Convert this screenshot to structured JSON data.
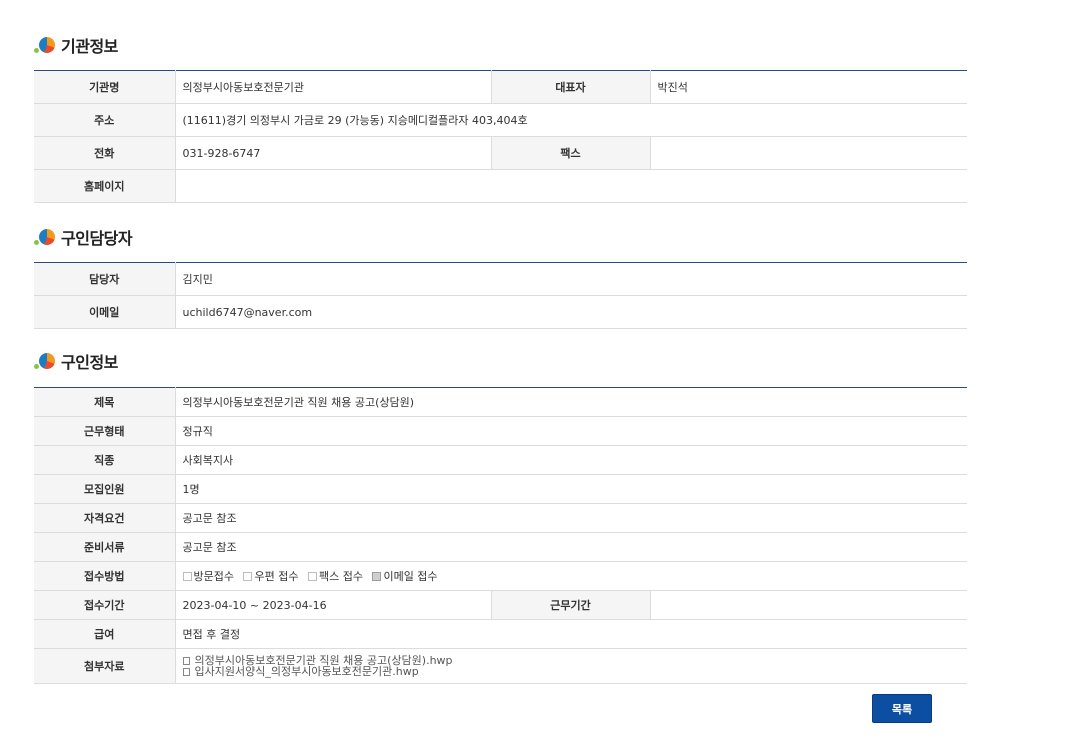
{
  "org_section": {
    "title": "기관정보",
    "name_label": "기관명",
    "name_value": "의정부시아동보호전문기관",
    "rep_label": "대표자",
    "rep_value": "박진석",
    "address_label": "주소",
    "address_value": "(11611)경기 의정부시 가금로 29 (가능동) 지승메디컬플라자 403,404호",
    "phone_label": "전화",
    "phone_value": "031-928-6747",
    "fax_label": "팩스",
    "fax_value": "",
    "homepage_label": "홈페이지",
    "homepage_value": ""
  },
  "contact_section": {
    "title": "구인담당자",
    "manager_label": "담당자",
    "manager_value": "김지민",
    "email_label": "이메일",
    "email_value": "uchild6747@naver.com"
  },
  "job_section": {
    "title": "구인정보",
    "subject_label": "제목",
    "subject_value": "의정부시아동보호전문기관 직원 채용 공고(상담원)",
    "work_type_label": "근무형태",
    "work_type_value": "정규직",
    "job_kind_label": "직종",
    "job_kind_value": "사회복지사",
    "headcount_label": "모집인원",
    "headcount_value": "1명",
    "qualification_label": "자격요건",
    "qualification_value": "공고문 참조",
    "documents_label": "준비서류",
    "documents_value": "공고문 참조",
    "method_label": "접수방법",
    "methods": [
      {
        "label": "방문접수",
        "checked": false
      },
      {
        "label": "우편 접수",
        "checked": false
      },
      {
        "label": "팩스 접수",
        "checked": false
      },
      {
        "label": "이메일 접수",
        "checked": true
      }
    ],
    "period_label": "접수기간",
    "period_value": "2023-04-10 ~ 2023-04-16",
    "work_period_label": "근무기간",
    "work_period_value": "",
    "salary_label": "급여",
    "salary_value": "면접 후 결정",
    "attachments_label": "첨부자료",
    "attachments": [
      "의정부시아동보호전문기관 직원 채용 공고(상담원).hwp",
      "입사지원서양식_의정부시아동보호전문기관.hwp"
    ]
  },
  "list_button_label": "목록"
}
